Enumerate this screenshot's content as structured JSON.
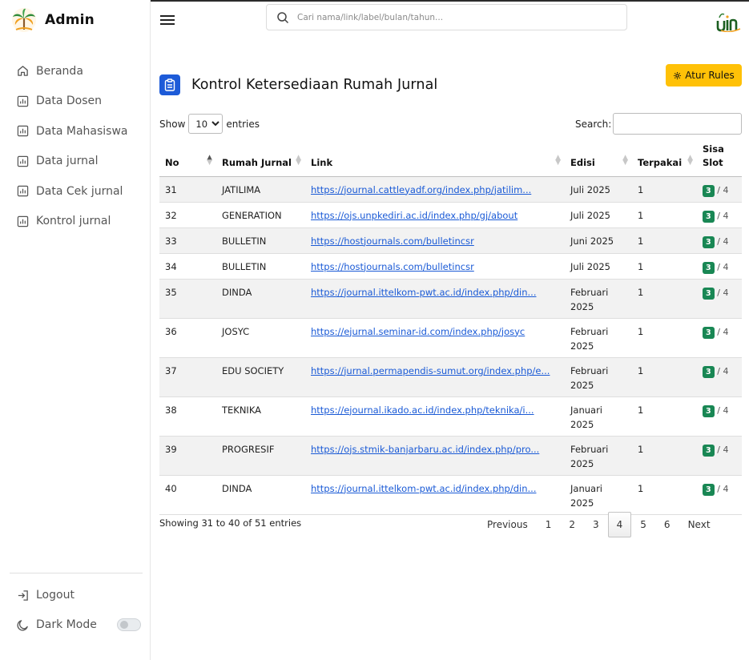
{
  "sidebar": {
    "brand": "Admin",
    "items": [
      {
        "label": "Beranda",
        "icon": "home-icon"
      },
      {
        "label": "Data Dosen",
        "icon": "bar-chart-icon"
      },
      {
        "label": "Data Mahasiswa",
        "icon": "bar-chart-icon"
      },
      {
        "label": "Data jurnal",
        "icon": "bar-chart-icon"
      },
      {
        "label": "Data Cek jurnal",
        "icon": "bar-chart-icon"
      },
      {
        "label": "Kontrol jurnal",
        "icon": "bar-chart-icon"
      }
    ],
    "logout": "Logout",
    "dark_mode": "Dark Mode",
    "dark_mode_on": false
  },
  "topbar": {
    "search_placeholder": "Cari nama/link/label/bulan/tahun..."
  },
  "page": {
    "title": "Kontrol Ketersediaan Rumah Jurnal",
    "rules_button": "Atur Rules"
  },
  "table_controls": {
    "show_label": "Show",
    "entries_label": "entries",
    "length_value": "10",
    "search_label": "Search:"
  },
  "table": {
    "columns": [
      {
        "label": "No",
        "sorted": "asc"
      },
      {
        "label": "Rumah Jurnal"
      },
      {
        "label": "Link"
      },
      {
        "label": "Edisi"
      },
      {
        "label": "Terpakai"
      },
      {
        "label": "Sisa Slot"
      }
    ],
    "rows": [
      {
        "no": "31",
        "rumah": "JATILIMA",
        "link": "https://journal.cattleyadf.org/index.php/jatilim...",
        "edisi": "Juli 2025",
        "terpakai": "1",
        "sisa": "3",
        "total": "/ 4"
      },
      {
        "no": "32",
        "rumah": "GENERATION",
        "link": "https://ojs.unpkediri.ac.id/index.php/gj/about",
        "edisi": "Juli 2025",
        "terpakai": "1",
        "sisa": "3",
        "total": "/ 4"
      },
      {
        "no": "33",
        "rumah": "BULLETIN",
        "link": "https://hostjournals.com/bulletincsr",
        "edisi": "Juni 2025",
        "terpakai": "1",
        "sisa": "3",
        "total": "/ 4"
      },
      {
        "no": "34",
        "rumah": "BULLETIN",
        "link": "https://hostjournals.com/bulletincsr",
        "edisi": "Juli 2025",
        "terpakai": "1",
        "sisa": "3",
        "total": "/ 4"
      },
      {
        "no": "35",
        "rumah": "DINDA",
        "link": "https://journal.ittelkom-pwt.ac.id/index.php/din...",
        "edisi": "Februari 2025",
        "terpakai": "1",
        "sisa": "3",
        "total": "/ 4"
      },
      {
        "no": "36",
        "rumah": "JOSYC",
        "link": "https://ejurnal.seminar-id.com/index.php/josyc",
        "edisi": "Februari 2025",
        "terpakai": "1",
        "sisa": "3",
        "total": "/ 4"
      },
      {
        "no": "37",
        "rumah": "EDU SOCIETY",
        "link": "https://jurnal.permapendis-sumut.org/index.php/e...",
        "edisi": "Februari 2025",
        "terpakai": "1",
        "sisa": "3",
        "total": "/ 4"
      },
      {
        "no": "38",
        "rumah": "TEKNIKA",
        "link": "https://ejournal.ikado.ac.id/index.php/teknika/i...",
        "edisi": "Januari 2025",
        "terpakai": "1",
        "sisa": "3",
        "total": "/ 4"
      },
      {
        "no": "39",
        "rumah": "PROGRESIF",
        "link": "https://ojs.stmik-banjarbaru.ac.id/index.php/pro...",
        "edisi": "Februari 2025",
        "terpakai": "1",
        "sisa": "3",
        "total": "/ 4"
      },
      {
        "no": "40",
        "rumah": "DINDA",
        "link": "https://journal.ittelkom-pwt.ac.id/index.php/din...",
        "edisi": "Januari 2025",
        "terpakai": "1",
        "sisa": "3",
        "total": "/ 4"
      }
    ]
  },
  "footer": {
    "info": "Showing 31 to 40 of 51 entries",
    "previous": "Previous",
    "next": "Next",
    "pages": [
      "1",
      "2",
      "3",
      "4",
      "5",
      "6"
    ],
    "current_page": "4"
  },
  "colors": {
    "accent_blue": "#1d5bd8",
    "rules_yellow": "#ffc107",
    "badge_green": "#198754",
    "link_blue": "#1a5ad6"
  }
}
